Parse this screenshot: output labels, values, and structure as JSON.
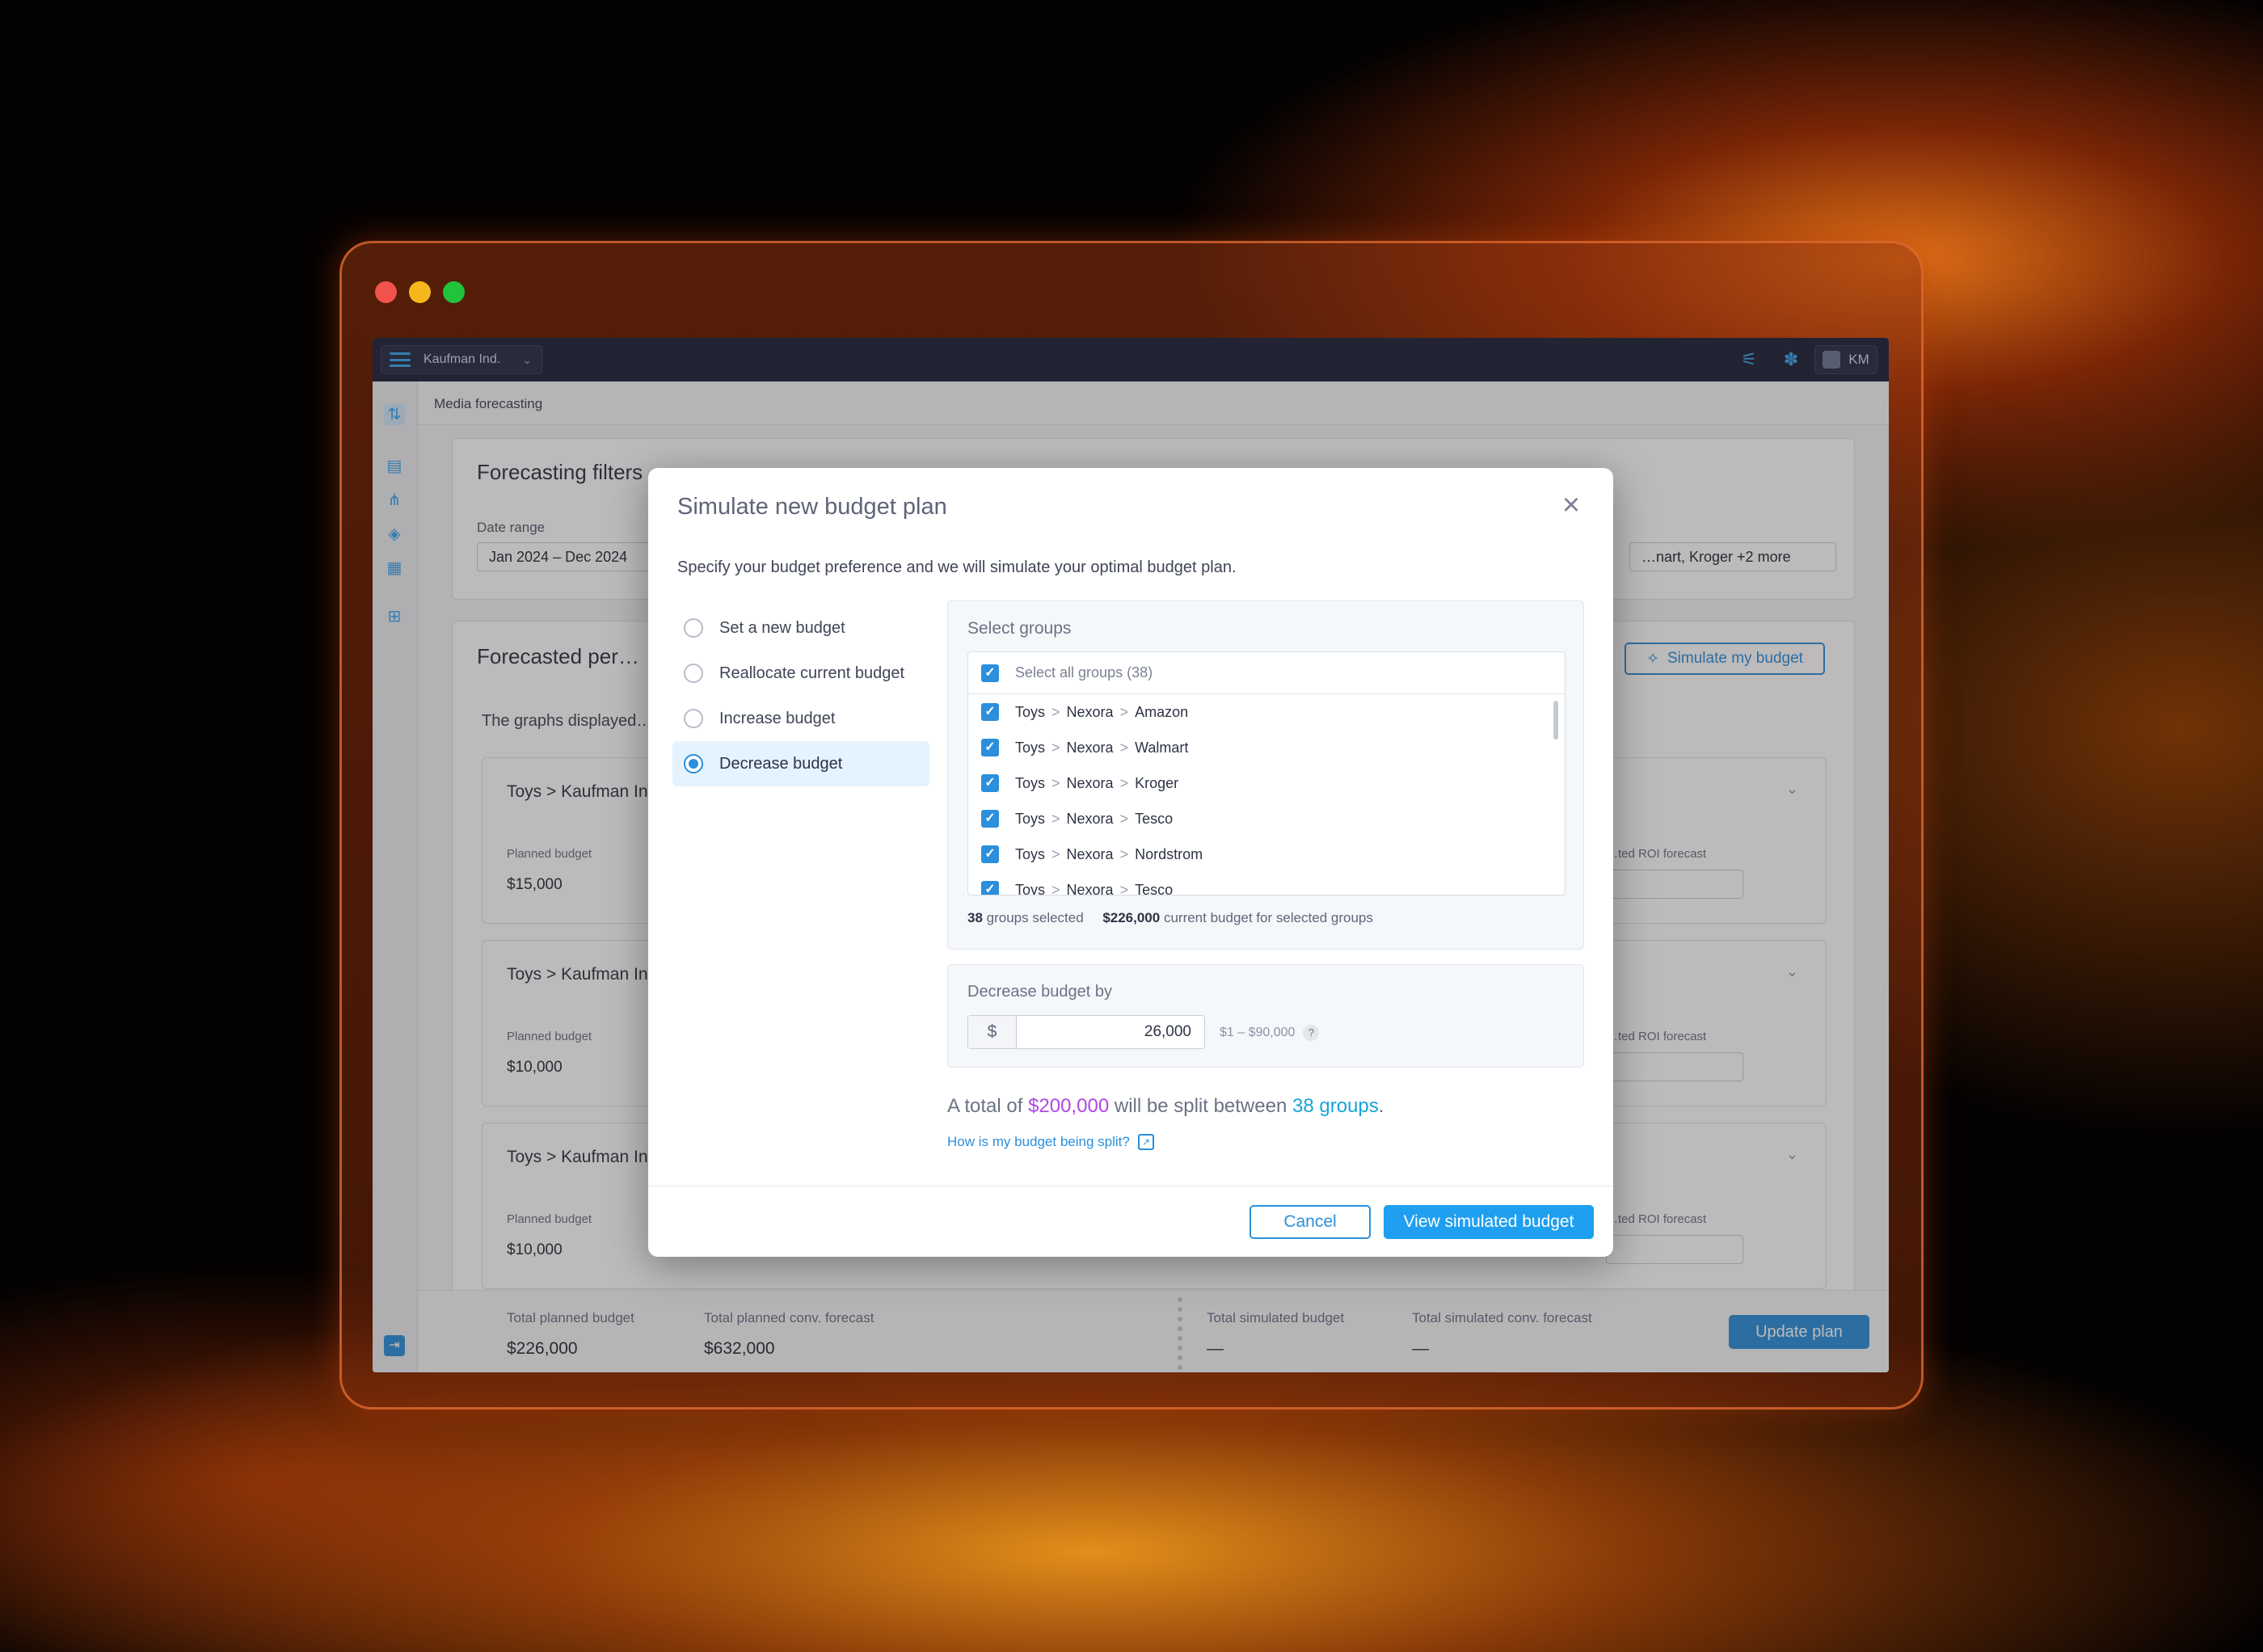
{
  "app": {
    "org_name": "Kaufman Ind.",
    "user_initials": "KM",
    "breadcrumb": "Media forecasting"
  },
  "filters": {
    "title": "Forecasting filters",
    "date_range_label": "Date range",
    "date_range_value": "Jan 2024 – Dec 2024",
    "retailers_value": "…nart, Kroger +2 more"
  },
  "forecast": {
    "title": "Forecasted per…",
    "subtitle": "The graphs displayed…",
    "simulate_button": "Simulate my budget",
    "rows": [
      {
        "title": "Toys > Kaufman In…",
        "planned_label": "Planned budget",
        "planned_value": "$15,000",
        "roi_label": "…ted ROI forecast"
      },
      {
        "title": "Toys > Kaufman In…",
        "planned_label": "Planned budget",
        "planned_value": "$10,000",
        "roi_label": "…ted ROI forecast"
      },
      {
        "title": "Toys > Kaufman In…",
        "planned_label": "Planned budget",
        "planned_value": "$10,000",
        "roi_label": "…ted ROI forecast"
      }
    ]
  },
  "footer": {
    "total_planned_label": "Total planned budget",
    "total_planned_value": "$226,000",
    "total_conv_label": "Total planned conv. forecast",
    "total_conv_value": "$632,000",
    "total_sim_label": "Total simulated budget",
    "total_sim_value": "—",
    "total_sim_conv_label": "Total simulated conv. forecast",
    "total_sim_conv_value": "—",
    "update_button": "Update plan"
  },
  "modal": {
    "title": "Simulate new budget plan",
    "description": "Specify your budget preference and we will simulate your optimal budget plan.",
    "options": [
      {
        "label": "Set a new budget",
        "selected": false
      },
      {
        "label": "Reallocate current budget",
        "selected": false
      },
      {
        "label": "Increase budget",
        "selected": false
      },
      {
        "label": "Decrease budget",
        "selected": true
      }
    ],
    "groups_panel": {
      "title": "Select groups",
      "select_all_label": "Select all groups (38)",
      "groups": [
        {
          "category": "Toys",
          "brand": "Nexora",
          "retailer": "Amazon"
        },
        {
          "category": "Toys",
          "brand": "Nexora",
          "retailer": "Walmart"
        },
        {
          "category": "Toys",
          "brand": "Nexora",
          "retailer": "Kroger"
        },
        {
          "category": "Toys",
          "brand": "Nexora",
          "retailer": "Tesco"
        },
        {
          "category": "Toys",
          "brand": "Nexora",
          "retailer": "Nordstrom"
        },
        {
          "category": "Toys",
          "brand": "Nexora",
          "retailer": "Tesco"
        }
      ],
      "selected_count": "38",
      "selected_count_suffix": "groups selected",
      "current_budget": "$226,000",
      "current_budget_suffix": "current budget for selected groups"
    },
    "decrease_panel": {
      "title": "Decrease budget by",
      "currency": "$",
      "value": "26,000",
      "range": "$1 – $90,000",
      "help": "?"
    },
    "summary": {
      "prefix": "A total of",
      "amount": "$200,000",
      "middle": "will be split between",
      "groups": "38 groups",
      "suffix": "."
    },
    "help_link": "How is my budget being split?",
    "cancel_button": "Cancel",
    "view_button": "View simulated budget"
  },
  "colors": {
    "accent": "#2b8fdc",
    "amount_highlight": "#b046e6",
    "groups_highlight": "#18a3d8",
    "topbar": "#1d2338"
  }
}
